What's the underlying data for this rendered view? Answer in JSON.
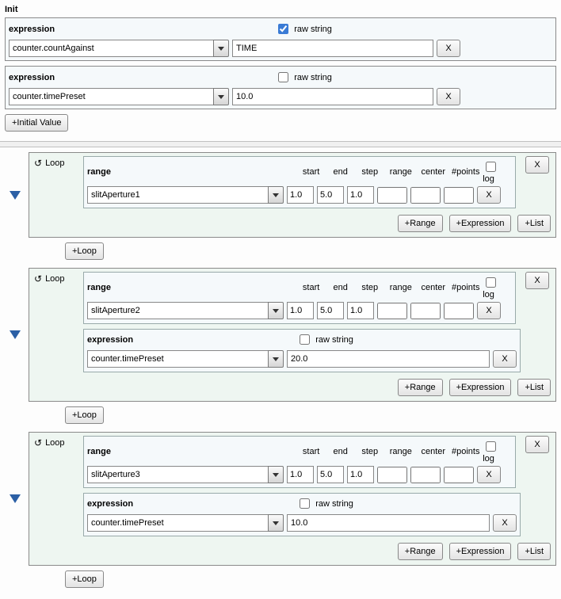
{
  "initTitle": "Init",
  "labels": {
    "expression": "expression",
    "rawString": "raw string",
    "range": "range",
    "start": "start",
    "end": "end",
    "step": "step",
    "rangeCol": "range",
    "center": "center",
    "points": "#points",
    "log": "log",
    "loop": "Loop",
    "x": "X"
  },
  "buttons": {
    "initialValue": "+Initial Value",
    "addRange": "+Range",
    "addExpression": "+Expression",
    "addList": "+List",
    "addLoop": "+Loop"
  },
  "init": [
    {
      "expr": "counter.countAgainst",
      "value": "TIME",
      "raw": true
    },
    {
      "expr": "counter.timePreset",
      "value": "10.0",
      "raw": false
    }
  ],
  "loops": [
    {
      "range": {
        "var": "slitAperture1",
        "start": "1.0",
        "end": "5.0",
        "step": "1.0",
        "range": "",
        "center": "",
        "points": "",
        "log": false
      },
      "exprs": []
    },
    {
      "range": {
        "var": "slitAperture2",
        "start": "1.0",
        "end": "5.0",
        "step": "1.0",
        "range": "",
        "center": "",
        "points": "",
        "log": false
      },
      "exprs": [
        {
          "expr": "counter.timePreset",
          "value": "20.0",
          "raw": false
        }
      ]
    },
    {
      "range": {
        "var": "slitAperture3",
        "start": "1.0",
        "end": "5.0",
        "step": "1.0",
        "range": "",
        "center": "",
        "points": "",
        "log": false
      },
      "exprs": [
        {
          "expr": "counter.timePreset",
          "value": "10.0",
          "raw": false
        }
      ]
    }
  ]
}
